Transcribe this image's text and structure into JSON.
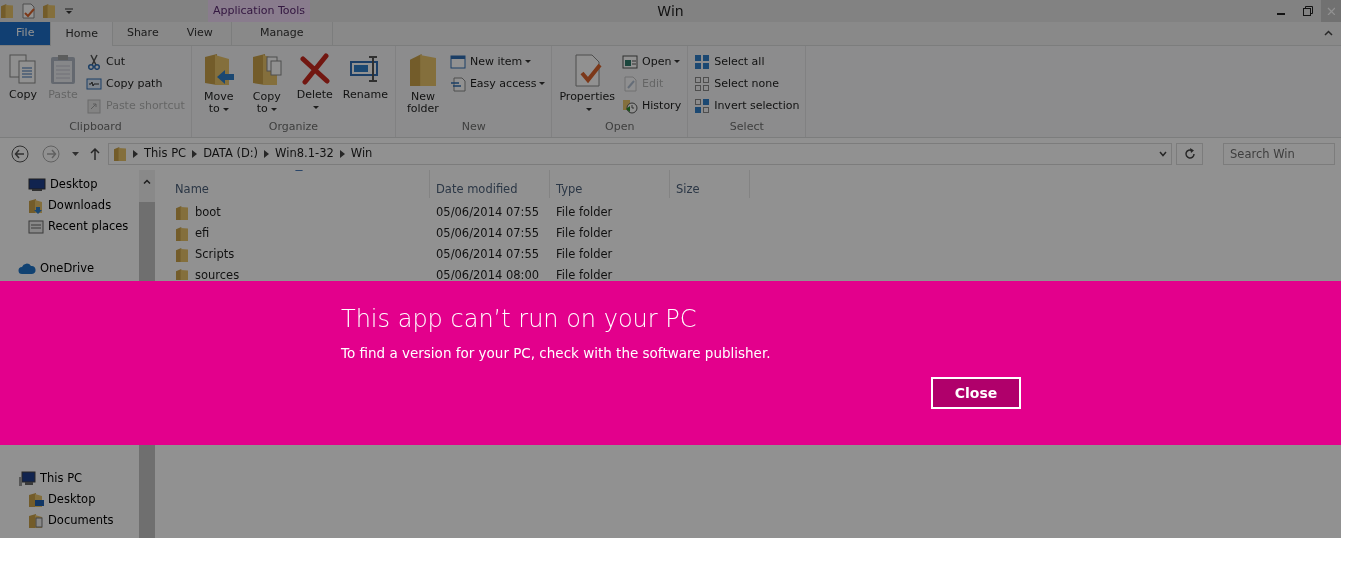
{
  "window": {
    "title": "Win"
  },
  "contextual_tab_group": "Application Tools",
  "ribbon_tabs": [
    {
      "label": "File",
      "kind": "file",
      "selected": false
    },
    {
      "label": "Home",
      "kind": "tab",
      "selected": true
    },
    {
      "label": "Share",
      "kind": "tab",
      "selected": false
    },
    {
      "label": "View",
      "kind": "tab",
      "selected": false
    },
    {
      "label": "Manage",
      "kind": "contextual",
      "selected": false
    }
  ],
  "ribbon_groups": [
    {
      "label": "Clipboard",
      "commands": [
        {
          "label": "Copy",
          "kind": "large",
          "disabled": false,
          "dropdown": false
        },
        {
          "label": "Paste",
          "kind": "large",
          "disabled": true,
          "dropdown": false
        },
        {
          "label": "Cut",
          "kind": "small",
          "disabled": false,
          "dropdown": false
        },
        {
          "label": "Copy path",
          "kind": "small",
          "disabled": false,
          "dropdown": false
        },
        {
          "label": "Paste shortcut",
          "kind": "small",
          "disabled": true,
          "dropdown": false
        }
      ]
    },
    {
      "label": "Organize",
      "commands": [
        {
          "label": "Move to",
          "kind": "large",
          "disabled": false,
          "dropdown": true
        },
        {
          "label": "Copy to",
          "kind": "large",
          "disabled": false,
          "dropdown": true
        },
        {
          "label": "Delete",
          "kind": "large",
          "disabled": false,
          "dropdown": true
        },
        {
          "label": "Rename",
          "kind": "large",
          "disabled": false,
          "dropdown": false
        }
      ]
    },
    {
      "label": "New",
      "commands": [
        {
          "label": "New folder",
          "kind": "large",
          "disabled": false,
          "dropdown": false
        },
        {
          "label": "New item",
          "kind": "small",
          "disabled": false,
          "dropdown": true
        },
        {
          "label": "Easy access",
          "kind": "small",
          "disabled": false,
          "dropdown": true
        }
      ]
    },
    {
      "label": "Open",
      "commands": [
        {
          "label": "Properties",
          "kind": "large",
          "disabled": false,
          "dropdown": true
        },
        {
          "label": "Open",
          "kind": "small",
          "disabled": false,
          "dropdown": true
        },
        {
          "label": "Edit",
          "kind": "small",
          "disabled": true,
          "dropdown": false
        },
        {
          "label": "History",
          "kind": "small",
          "disabled": false,
          "dropdown": false
        }
      ]
    },
    {
      "label": "Select",
      "commands": [
        {
          "label": "Select all",
          "kind": "small",
          "disabled": false,
          "dropdown": false
        },
        {
          "label": "Select none",
          "kind": "small",
          "disabled": false,
          "dropdown": false
        },
        {
          "label": "Invert selection",
          "kind": "small",
          "disabled": false,
          "dropdown": false
        }
      ]
    }
  ],
  "address_bar": {
    "breadcrumbs": [
      "This PC",
      "DATA (D:)",
      "Win8.1-32",
      "Win"
    ]
  },
  "search": {
    "placeholder": "Search Win"
  },
  "navigation_pane": [
    {
      "label": "Desktop",
      "kind": "favorite"
    },
    {
      "label": "Downloads",
      "kind": "favorite"
    },
    {
      "label": "Recent places",
      "kind": "favorite"
    },
    {
      "label": "OneDrive",
      "kind": "cloud"
    },
    {
      "label": "This PC",
      "kind": "computer",
      "children": [
        {
          "label": "Desktop",
          "kind": "folder"
        },
        {
          "label": "Documents",
          "kind": "folder"
        }
      ]
    }
  ],
  "file_list": {
    "columns": [
      {
        "label": "Name",
        "sorted": true
      },
      {
        "label": "Date modified",
        "sorted": false
      },
      {
        "label": "Type",
        "sorted": false
      },
      {
        "label": "Size",
        "sorted": false
      }
    ],
    "rows": [
      {
        "name": "boot",
        "date_modified": "05/06/2014 07:55",
        "type": "File folder"
      },
      {
        "name": "efi",
        "date_modified": "05/06/2014 07:55",
        "type": "File folder"
      },
      {
        "name": "Scripts",
        "date_modified": "05/06/2014 07:55",
        "type": "File folder"
      },
      {
        "name": "sources",
        "date_modified": "05/06/2014 08:00",
        "type": "File folder"
      }
    ]
  },
  "error_banner": {
    "title": "This app can’t run on your PC",
    "message": "To find a version for your PC, check with the software publisher.",
    "button": "Close"
  }
}
